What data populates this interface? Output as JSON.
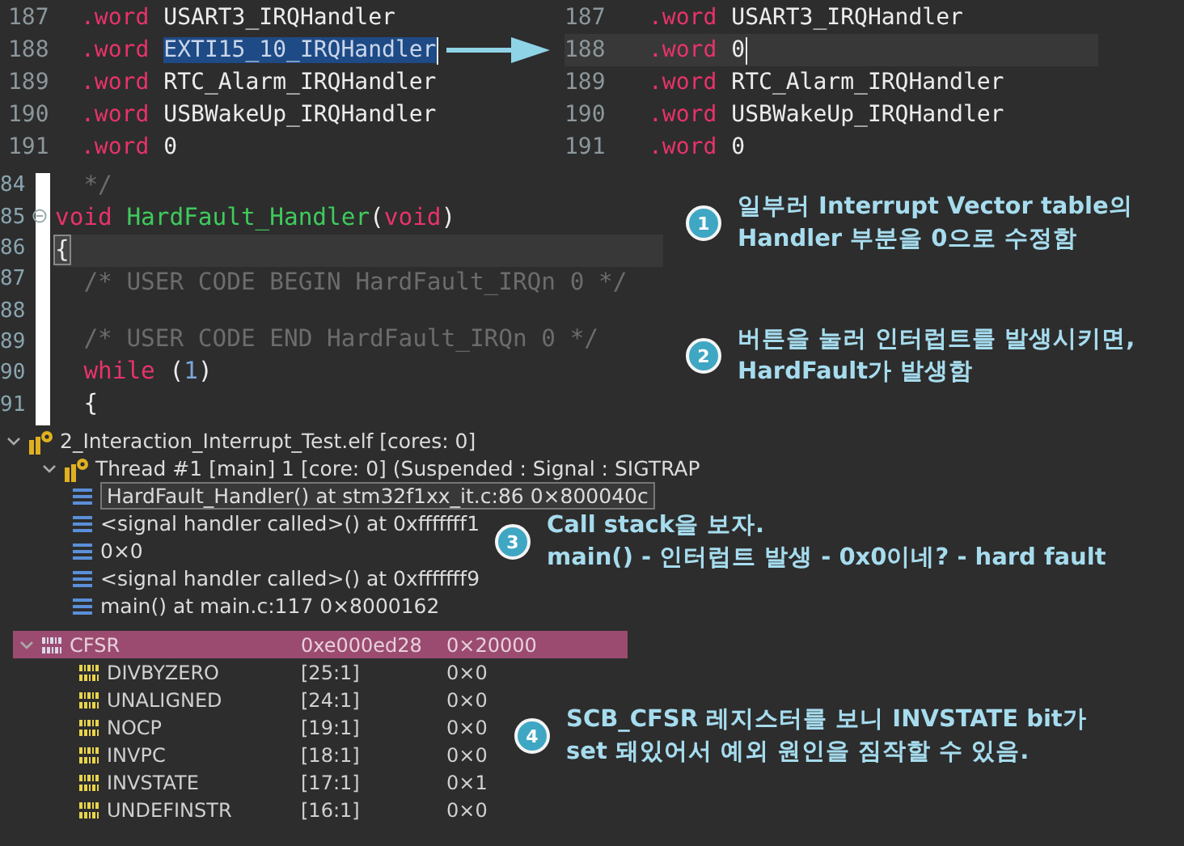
{
  "asm_panels": [
    {
      "lines": [
        {
          "number": "187",
          "directive": ".word",
          "operand": "USART3_IRQHandler",
          "selected": false,
          "current": false
        },
        {
          "number": "188",
          "directive": ".word",
          "operand": "EXTI15_10_IRQHandler",
          "selected": true,
          "current": false
        },
        {
          "number": "189",
          "directive": ".word",
          "operand": "RTC_Alarm_IRQHandler",
          "selected": false,
          "current": false
        },
        {
          "number": "190",
          "directive": ".word",
          "operand": "USBWakeUp_IRQHandler",
          "selected": false,
          "current": false
        },
        {
          "number": "191",
          "directive": ".word",
          "operand": "0",
          "selected": false,
          "current": false
        }
      ]
    },
    {
      "lines": [
        {
          "number": "187",
          "directive": ".word",
          "operand": "USART3_IRQHandler",
          "selected": false,
          "current": false
        },
        {
          "number": "188",
          "directive": ".word",
          "operand": "0",
          "selected": false,
          "current": true
        },
        {
          "number": "189",
          "directive": ".word",
          "operand": "RTC_Alarm_IRQHandler",
          "selected": false,
          "current": false
        },
        {
          "number": "190",
          "directive": ".word",
          "operand": "USBWakeUp_IRQHandler",
          "selected": false,
          "current": false
        },
        {
          "number": "191",
          "directive": ".word",
          "operand": "0",
          "selected": false,
          "current": false
        }
      ]
    }
  ],
  "code": {
    "lines": [
      {
        "number": "84",
        "current": false,
        "foldable": false,
        "tokens": [
          {
            "kind": "comment",
            "text": "  */"
          }
        ]
      },
      {
        "number": "85",
        "current": false,
        "foldable": true,
        "tokens": [
          {
            "kind": "keyword",
            "text": "void"
          },
          {
            "kind": "function",
            "text": " HardFault_Handler"
          },
          {
            "kind": "plain",
            "text": "("
          },
          {
            "kind": "keyword",
            "text": "void"
          },
          {
            "kind": "plain",
            "text": ")"
          }
        ]
      },
      {
        "number": "86",
        "current": true,
        "foldable": false,
        "tokens": [
          {
            "kind": "plain",
            "text": "{"
          }
        ]
      },
      {
        "number": "87",
        "current": false,
        "foldable": false,
        "tokens": [
          {
            "kind": "comment",
            "text": "  /* USER CODE BEGIN HardFault_IRQn 0 */"
          }
        ]
      },
      {
        "number": "88",
        "current": false,
        "foldable": false
      },
      {
        "number": "89",
        "current": false,
        "foldable": false,
        "tokens": [
          {
            "kind": "comment",
            "text": "  /* USER CODE END HardFault_IRQn 0 */"
          }
        ]
      },
      {
        "number": "90",
        "current": false,
        "foldable": false,
        "tokens": [
          {
            "kind": "keyword",
            "text": "  while"
          },
          {
            "kind": "plain",
            "text": " ("
          },
          {
            "kind": "number",
            "text": "1"
          },
          {
            "kind": "plain",
            "text": ")"
          }
        ]
      },
      {
        "number": "91",
        "current": false,
        "foldable": false,
        "tokens": [
          {
            "kind": "plain",
            "text": "  {"
          }
        ]
      }
    ]
  },
  "debug_tree": {
    "label": "2_Interaction_Interrupt_Test.elf [cores: 0]",
    "expanded": true,
    "children": [
      {
        "label": "Thread #1 [main] 1 [core: 0] (Suspended : Signal : SIGTRAP",
        "expanded": true,
        "children": [
          {
            "label": "HardFault_Handler() at stm32f1xx_it.c:86 0×800040c",
            "selected": true
          },
          {
            "label": "<signal handler called>() at 0xfffffff1",
            "selected": false
          },
          {
            "label": "0×0",
            "selected": false
          },
          {
            "label": "<signal handler called>() at 0xfffffff9",
            "selected": false
          },
          {
            "label": "main() at main.c:117 0×8000162",
            "selected": false
          }
        ]
      }
    ]
  },
  "registers": {
    "name": "CFSR",
    "address": "0xe000ed28",
    "value": "0×20000",
    "expanded": true,
    "selected": true,
    "fields": [
      {
        "name": "DIVBYZERO",
        "bits": "[25:1]",
        "value": "0×0"
      },
      {
        "name": "UNALIGNED",
        "bits": "[24:1]",
        "value": "0×0"
      },
      {
        "name": "NOCP",
        "bits": "[19:1]",
        "value": "0×0"
      },
      {
        "name": "INVPC",
        "bits": "[18:1]",
        "value": "0×0"
      },
      {
        "name": "INVSTATE",
        "bits": "[17:1]",
        "value": "0×1"
      },
      {
        "name": "UNDEFINSTR",
        "bits": "[16:1]",
        "value": "0×0"
      }
    ]
  },
  "annotations": [
    {
      "number": "1",
      "text": "일부러 Interrupt Vector table의\nHandler 부분을 0으로 수정함"
    },
    {
      "number": "2",
      "text": "버튼을 눌러 인터럽트를 발생시키면,\nHardFault가 발생함"
    },
    {
      "number": "3",
      "text": "Call stack을 보자.\nmain() - 인터럽트 발생 - 0x0이네? - hard fault"
    },
    {
      "number": "4",
      "text": "SCB_CFSR 레지스터를 보니 INVSTATE bit가\nset 돼있어서 예외 원인을 짐작할 수 있음."
    }
  ]
}
